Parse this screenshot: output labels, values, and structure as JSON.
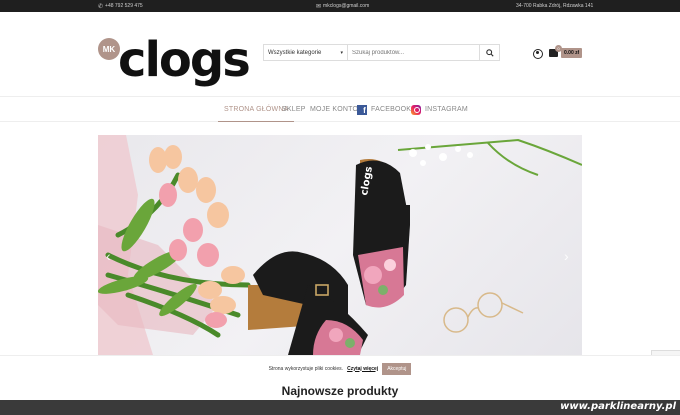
{
  "topbar": {
    "phone": "+48 792 529 475",
    "email": "mkclogs@gmail.com",
    "address": "34-700 Rabka Zdrój, Rdzawka 141"
  },
  "logo": {
    "badge": "MK",
    "word": "clogs"
  },
  "search": {
    "category_value": "Wszystkie kategorie",
    "placeholder": "Szukaj produktów..."
  },
  "cart": {
    "count": "0",
    "total": "0.00 zł"
  },
  "nav": {
    "items": [
      {
        "label": "STRONA GŁÓWNA"
      },
      {
        "label": "SKLEP"
      },
      {
        "label": "MOJE KONTO"
      },
      {
        "label": "FACEBOOK"
      },
      {
        "label": "INSTAGRAM"
      }
    ]
  },
  "hero": {
    "shoe_brand": "clogs"
  },
  "cookie": {
    "text": "Strona wykorzystuje pliki cookies.",
    "link": "Czytaj więcej",
    "accept": "Akceptuj"
  },
  "section": {
    "title": "Najnowsze produkty"
  },
  "watermark": "www.parklinearny.pl",
  "colors": {
    "accent": "#b0948a",
    "topbar": "#1f1f1f"
  }
}
